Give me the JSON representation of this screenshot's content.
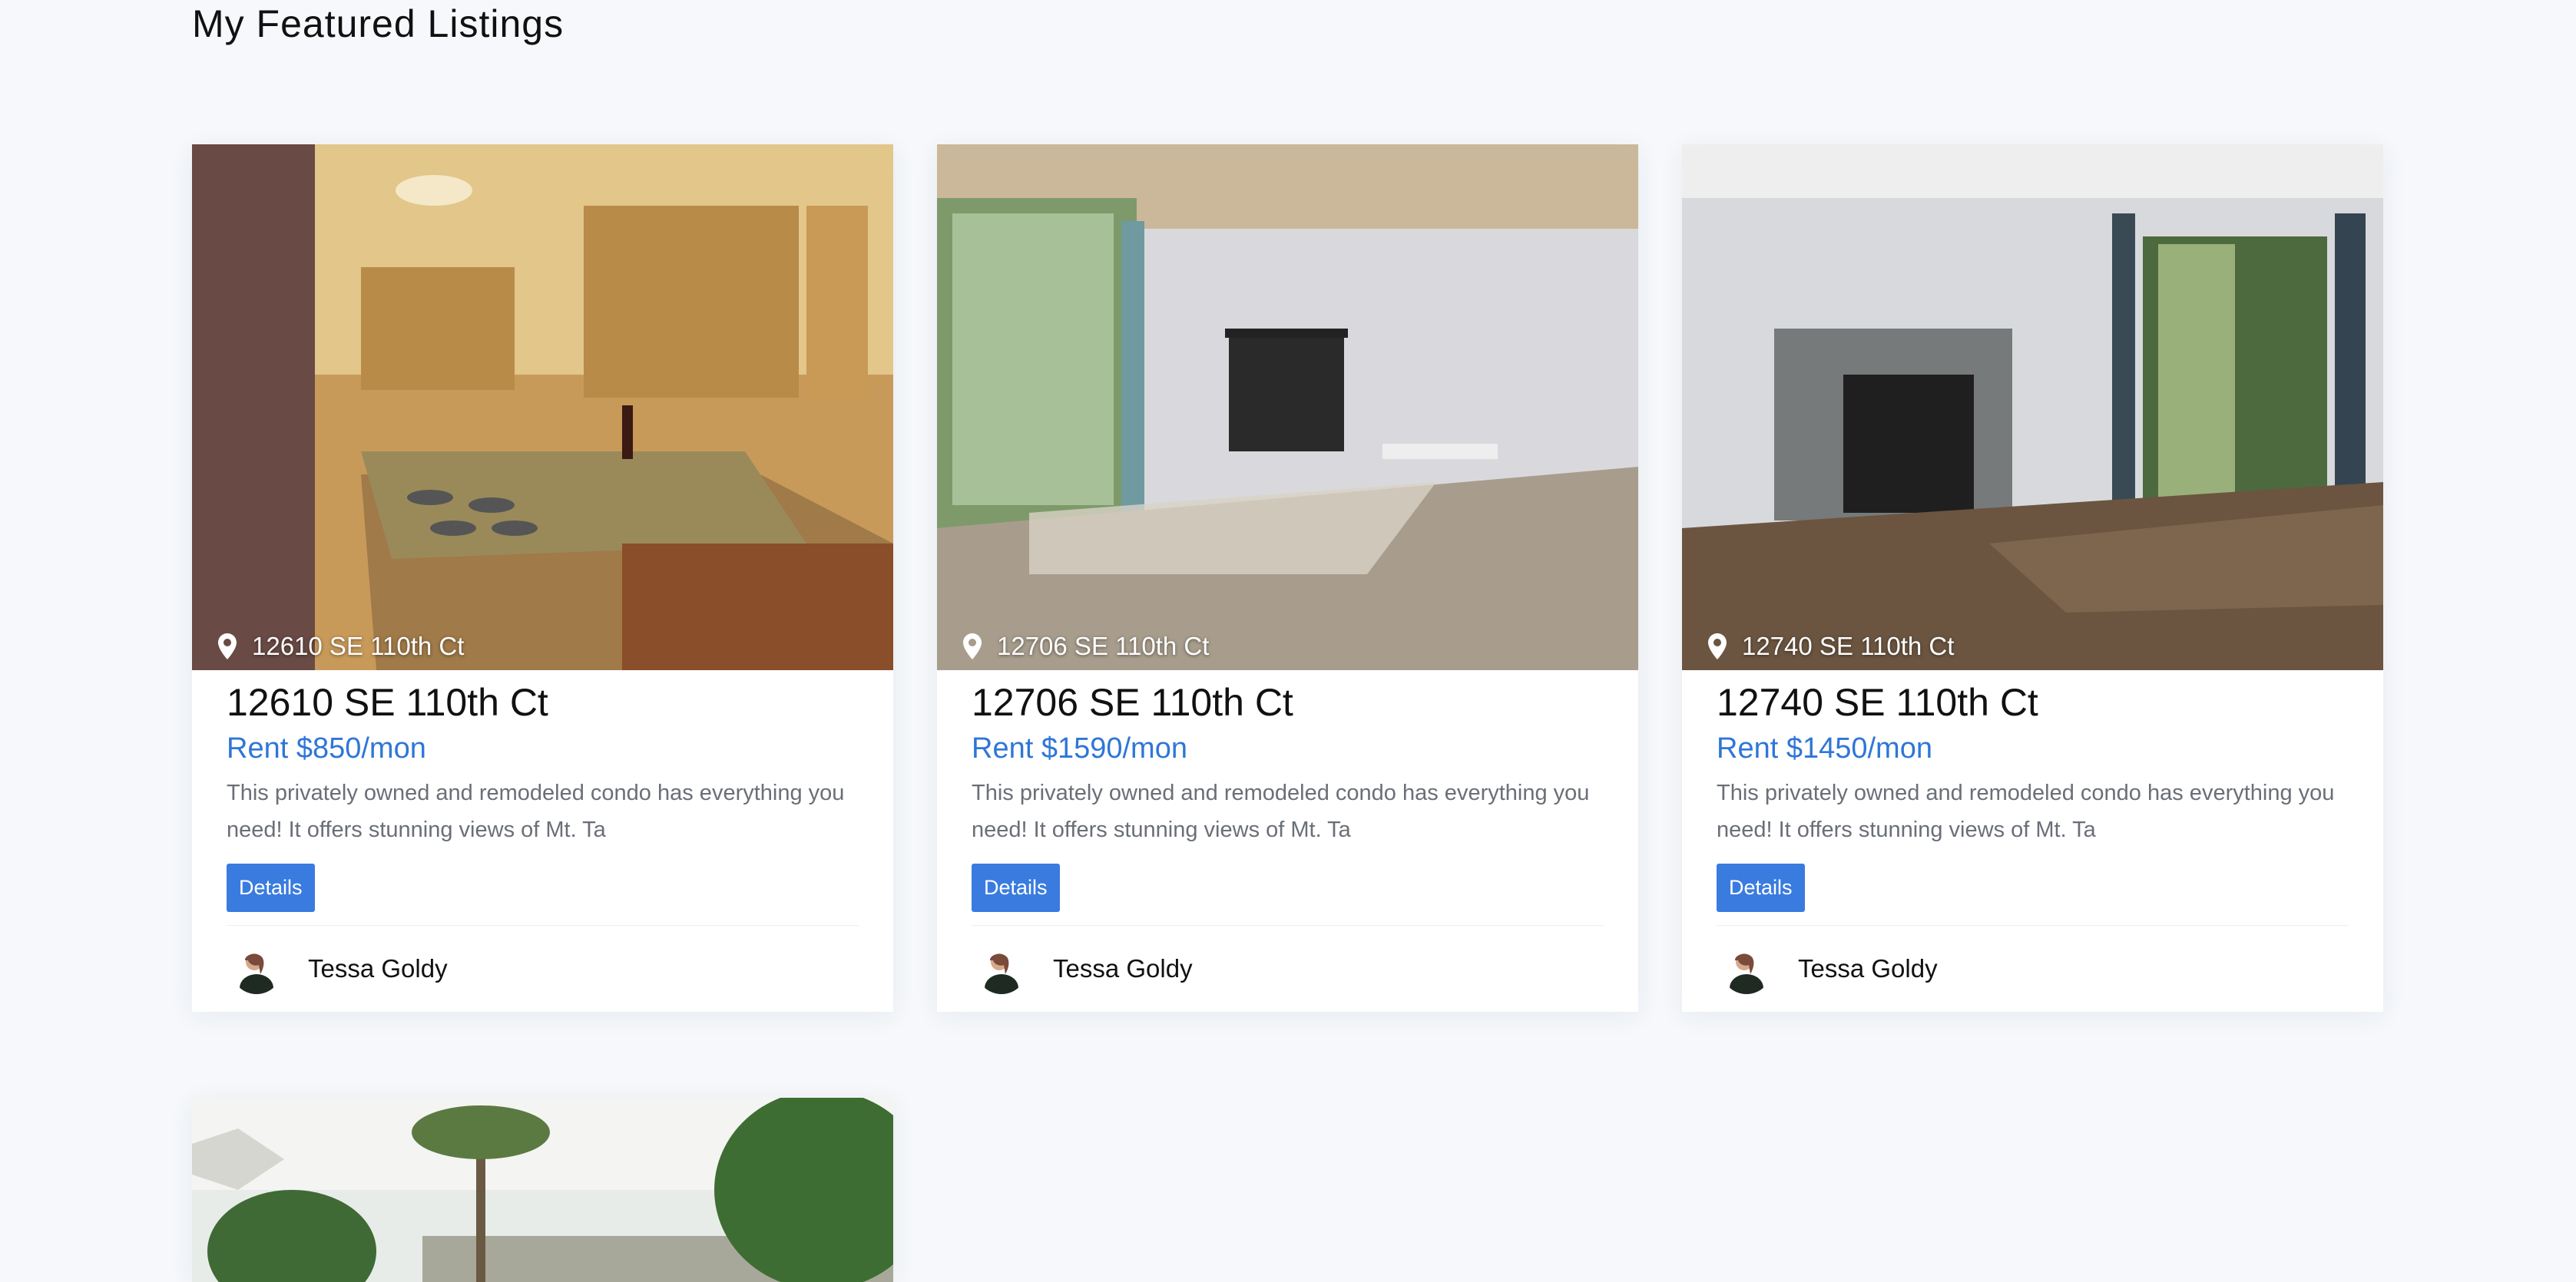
{
  "page": {
    "title": "My Featured Listings"
  },
  "listings": [
    {
      "caption": "12610 SE 110th Ct",
      "title": "12610 SE 110th Ct",
      "price": "Rent $850/mon",
      "description": "This privately owned and remodeled condo has everything you need! It offers stunning views of Mt. Ta",
      "button": "Details",
      "agent": "Tessa Goldy"
    },
    {
      "caption": "12706 SE 110th Ct",
      "title": "12706 SE 110th Ct",
      "price": "Rent $1590/mon",
      "description": "This privately owned and remodeled condo has everything you need! It offers stunning views of Mt. Ta",
      "button": "Details",
      "agent": "Tessa Goldy"
    },
    {
      "caption": "12740 SE 110th Ct",
      "title": "12740 SE 110th Ct",
      "price": "Rent $1450/mon",
      "description": "This privately owned and remodeled condo has everything you need! It offers stunning views of Mt. Ta",
      "button": "Details",
      "agent": "Tessa Goldy"
    }
  ],
  "colors": {
    "accent": "#3a7be0",
    "price": "#2f76d7",
    "background": "#f6f8fb"
  }
}
